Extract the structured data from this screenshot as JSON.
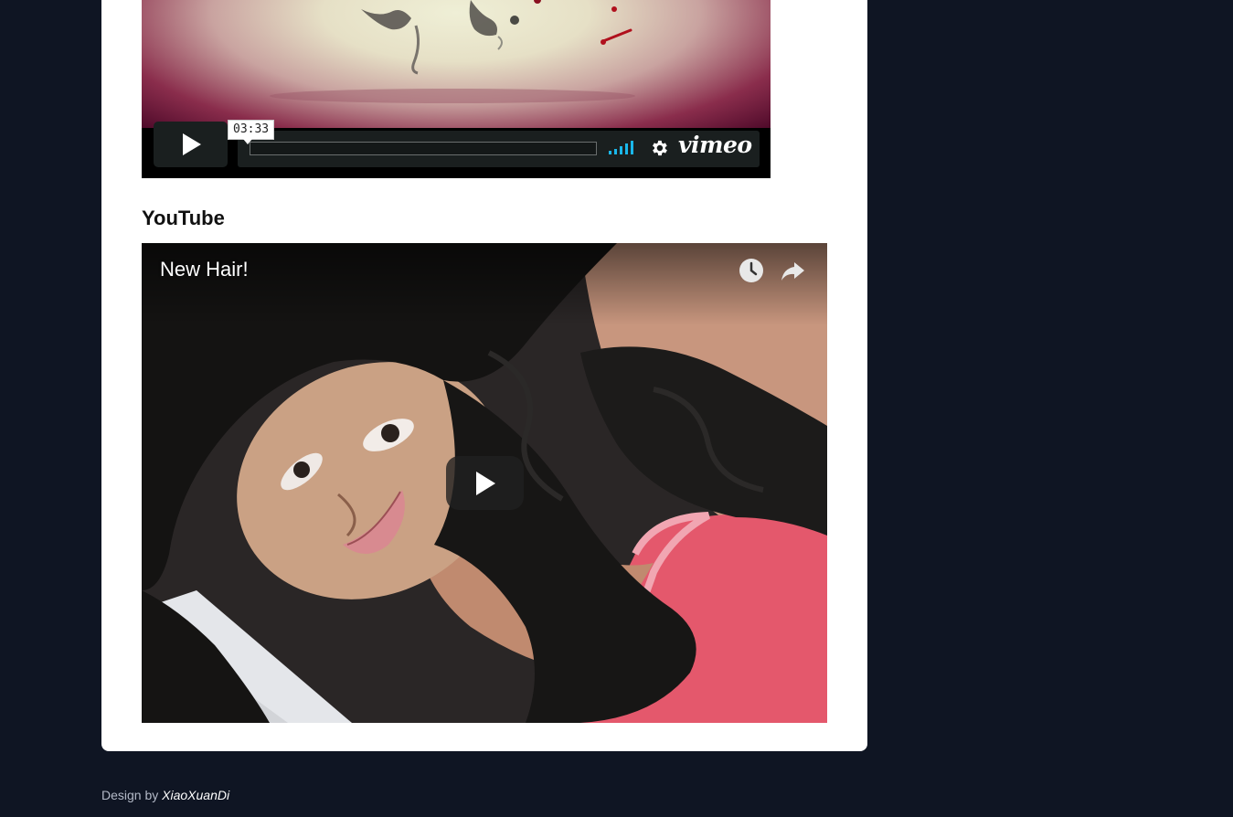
{
  "vimeo": {
    "tooltip_time": "03:33",
    "logo_text": "vimeo",
    "brand_color": "#1ab7ea",
    "icons": [
      "play-icon",
      "volume-icon",
      "gear-icon"
    ]
  },
  "youtube_section": {
    "heading": "YouTube"
  },
  "youtube": {
    "video_title": "New Hair!",
    "icons": [
      "watch-later-icon",
      "share-icon",
      "play-icon"
    ]
  },
  "footer": {
    "prefix": "Design by ",
    "author": "XiaoXuanDi"
  },
  "colors": {
    "page_background": "#0f1523",
    "card_background": "#ffffff"
  }
}
